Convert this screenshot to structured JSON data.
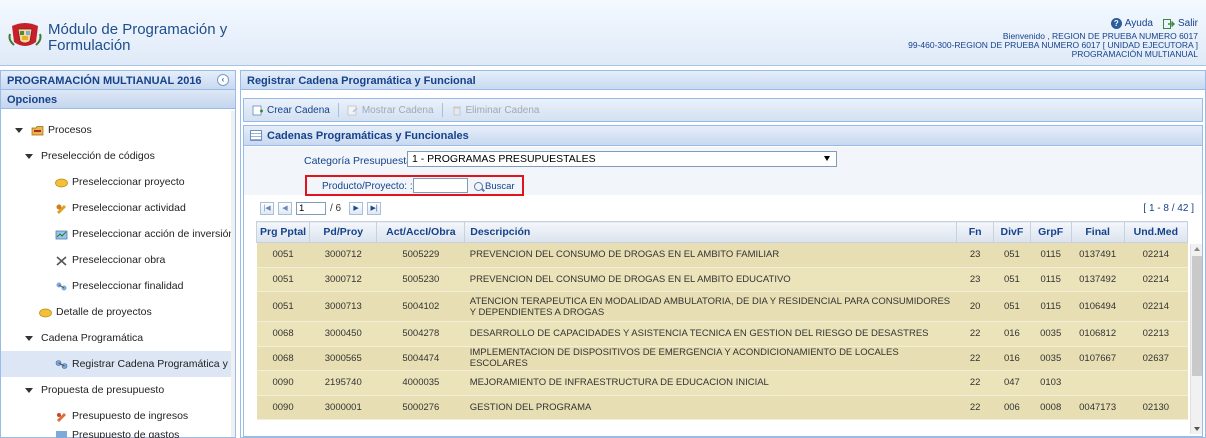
{
  "header": {
    "title_line1": "Módulo de Programación y",
    "title_line2": "Formulación",
    "help_label": "Ayuda",
    "exit_label": "Salir",
    "welcome": "Bienvenido , REGION DE PRUEBA NUMERO 6017",
    "unit": "99-460-300-REGION DE PRUEBA NUMERO 6017 [ UNIDAD EJECUTORA ]",
    "mode": "PROGRAMACIÓN MULTIANUAL"
  },
  "left_panel": {
    "title": "PROGRAMACIÓN MULTIANUAL 2016",
    "options_label": "Opciones",
    "items": [
      {
        "label": "Procesos",
        "level": 0,
        "icon": "folder-icon"
      },
      {
        "label": "Preselección de códigos",
        "level": 1,
        "icon": ""
      },
      {
        "label": "Preseleccionar proyecto",
        "level": 2,
        "icon": "project-icon"
      },
      {
        "label": "Preseleccionar actividad",
        "level": 2,
        "icon": "activity-icon"
      },
      {
        "label": "Preseleccionar acción de inversión",
        "level": 2,
        "icon": "investment-icon"
      },
      {
        "label": "Preseleccionar obra",
        "level": 2,
        "icon": "tools-icon"
      },
      {
        "label": "Preseleccionar finalidad",
        "level": 2,
        "icon": "finality-icon"
      },
      {
        "label": "Detalle de proyectos",
        "level": 1,
        "icon": "project-icon"
      },
      {
        "label": "Cadena Programática",
        "level": 1,
        "icon": ""
      },
      {
        "label": "Registrar Cadena Programática y Fu",
        "level": 2,
        "icon": "chain-icon",
        "selected": true
      },
      {
        "label": "Propuesta de presupuesto",
        "level": 1,
        "icon": ""
      },
      {
        "label": "Presupuesto de ingresos",
        "level": 2,
        "icon": "income-icon"
      },
      {
        "label": "Presupuesto de gastos",
        "level": 2,
        "icon": "expense-icon"
      }
    ]
  },
  "main": {
    "title": "Registrar Cadena Programática y Funcional",
    "toolbar": {
      "create": "Crear Cadena",
      "show": "Mostrar Cadena",
      "delete": "Eliminar Cadena"
    },
    "grid_title": "Cadenas Programáticas y Funcionales",
    "filters": {
      "category_label": "Categoría Presupuestal :",
      "category_value": "1 - PROGRAMAS PRESUPUESTALES",
      "product_label": "Producto/Proyecto: :",
      "product_value": "",
      "search_label": "Buscar"
    },
    "pager": {
      "page": "1",
      "of": "/ 6",
      "range": "[ 1 - 8 / 42 ]"
    },
    "table": {
      "columns": [
        "Prg Pptal",
        "Pd/Proy",
        "Act/AccI/Obra",
        "Descripción",
        "Fn",
        "DivF",
        "GrpF",
        "Final",
        "Und.Med"
      ],
      "rows": [
        [
          "0051",
          "3000712",
          "5005229",
          "PREVENCION DEL CONSUMO DE DROGAS EN EL AMBITO FAMILIAR",
          "23",
          "051",
          "0115",
          "0137491",
          "02214"
        ],
        [
          "0051",
          "3000712",
          "5005230",
          "PREVENCION DEL CONSUMO DE DROGAS EN EL AMBITO EDUCATIVO",
          "23",
          "051",
          "0115",
          "0137492",
          "02214"
        ],
        [
          "0051",
          "3000713",
          "5004102",
          "ATENCION TERAPEUTICA EN MODALIDAD AMBULATORIA, DE DIA Y RESIDENCIAL PARA CONSUMIDORES Y DEPENDIENTES A DROGAS",
          "20",
          "051",
          "0115",
          "0106494",
          "02214"
        ],
        [
          "0068",
          "3000450",
          "5004278",
          "DESARROLLO DE CAPACIDADES Y ASISTENCIA TECNICA EN GESTION DEL RIESGO DE DESASTRES",
          "22",
          "016",
          "0035",
          "0106812",
          "02213"
        ],
        [
          "0068",
          "3000565",
          "5004474",
          "IMPLEMENTACION DE DISPOSITIVOS DE EMERGENCIA Y ACONDICIONAMIENTO DE LOCALES ESCOLARES",
          "22",
          "016",
          "0035",
          "0107667",
          "02637"
        ],
        [
          "0090",
          "2195740",
          "4000035",
          "MEJORAMIENTO DE INFRAESTRUCTURA DE EDUCACION INICIAL",
          "22",
          "047",
          "0103",
          "",
          ""
        ],
        [
          "0090",
          "3000001",
          "5000276",
          "GESTION DEL PROGRAMA",
          "22",
          "006",
          "0008",
          "0047173",
          "02130"
        ]
      ]
    }
  },
  "colors": {
    "accent": "#15428b",
    "row_bg": "#e7dfb3",
    "highlight_box": "#e1141e"
  }
}
